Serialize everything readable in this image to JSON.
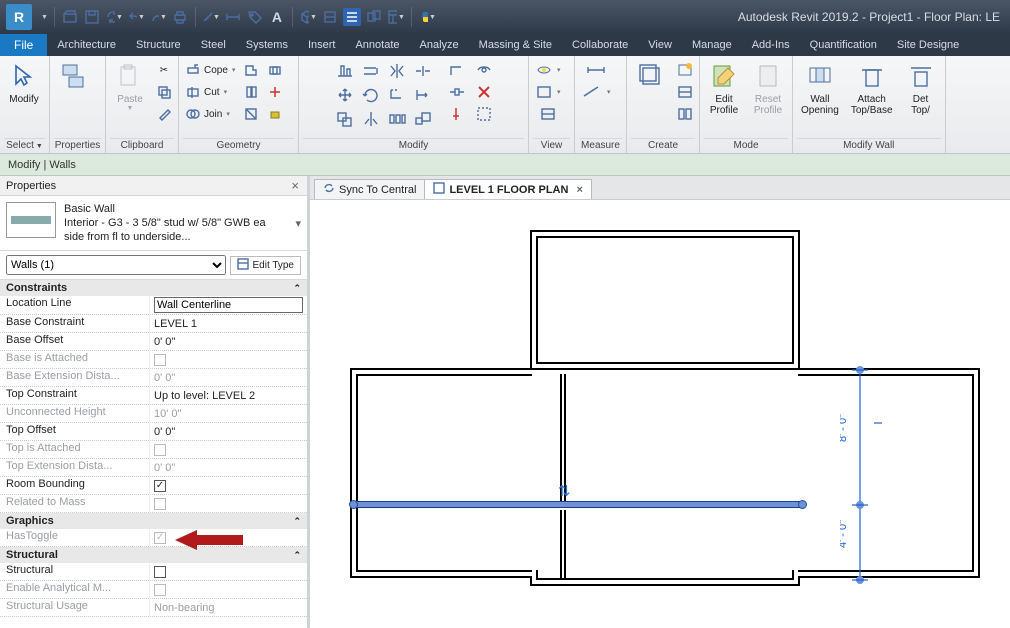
{
  "app_title": "Autodesk Revit 2019.2 - Project1 - Floor Plan: LE",
  "menu_tabs": {
    "file": "File",
    "items": [
      "Architecture",
      "Structure",
      "Steel",
      "Systems",
      "Insert",
      "Annotate",
      "Analyze",
      "Massing & Site",
      "Collaborate",
      "View",
      "Manage",
      "Add-Ins",
      "Quantification",
      "Site Designe"
    ]
  },
  "ribbon": {
    "modify": "Modify",
    "select": "Select",
    "properties": "Properties",
    "paste": "Paste",
    "clipboard": "Clipboard",
    "cope": "Cope",
    "cut": "Cut",
    "join": "Join",
    "geometry": "Geometry",
    "modify_panel": "Modify",
    "view": "View",
    "measure": "Measure",
    "create": "Create",
    "edit_profile": "Edit\nProfile",
    "reset_profile": "Reset\nProfile",
    "mode": "Mode",
    "wall_opening": "Wall\nOpening",
    "attach": "Attach\nTop/Base",
    "detach": "Det\nTop/",
    "modify_wall": "Modify Wall"
  },
  "context_bar": "Modify | Walls",
  "props": {
    "title": "Properties",
    "type_family": "Basic Wall",
    "type_name": "Interior - G3 - 3 5/8\" stud w/ 5/8\" GWB ea side from fl to underside...",
    "filter": "Walls (1)",
    "edit_type": "Edit Type",
    "groups": {
      "constraints": "Constraints",
      "graphics": "Graphics",
      "structural": "Structural"
    },
    "rows": {
      "location_line": {
        "k": "Location Line",
        "v": "Wall Centerline"
      },
      "base_constraint": {
        "k": "Base Constraint",
        "v": "LEVEL 1"
      },
      "base_offset": {
        "k": "Base Offset",
        "v": "0'  0\""
      },
      "base_attached": {
        "k": "Base is Attached",
        "v": ""
      },
      "base_ext": {
        "k": "Base Extension Dista...",
        "v": "0'  0\""
      },
      "top_constraint": {
        "k": "Top Constraint",
        "v": "Up to level: LEVEL 2"
      },
      "unconn_h": {
        "k": "Unconnected Height",
        "v": "10'  0\""
      },
      "top_offset": {
        "k": "Top Offset",
        "v": "0'  0\""
      },
      "top_attached": {
        "k": "Top is Attached",
        "v": ""
      },
      "top_ext": {
        "k": "Top Extension Dista...",
        "v": "0'  0\""
      },
      "room_bounding": {
        "k": "Room Bounding",
        "v": "on"
      },
      "related_mass": {
        "k": "Related to Mass",
        "v": ""
      },
      "has_toggle": {
        "k": "HasToggle",
        "v": "on"
      },
      "structural": {
        "k": "Structural",
        "v": "off"
      },
      "analytical": {
        "k": "Enable Analytical M...",
        "v": ""
      },
      "usage": {
        "k": "Structural Usage",
        "v": "Non-bearing"
      }
    }
  },
  "view_tabs": {
    "sync": "Sync To Central",
    "level": "LEVEL 1 FLOOR PLAN"
  },
  "dims": {
    "d1": "8' - 0\"",
    "d2": "4' - 0\""
  }
}
